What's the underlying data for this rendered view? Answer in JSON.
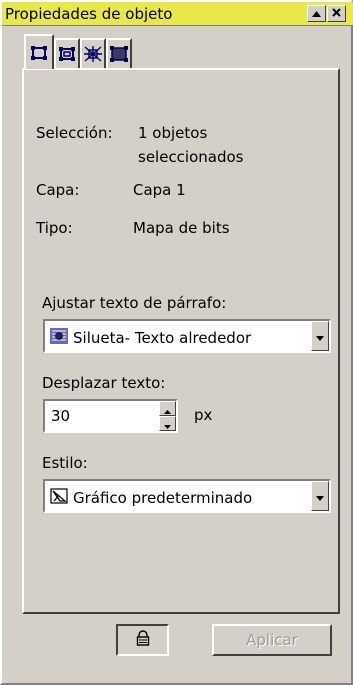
{
  "window": {
    "title": "Propiedades de objeto"
  },
  "tabs": [
    {
      "name": "tab-general",
      "icon": "object-frame-icon",
      "active": true
    },
    {
      "name": "tab-outline",
      "icon": "outline-frame-icon",
      "active": false
    },
    {
      "name": "tab-wrap",
      "icon": "wrap-text-icon",
      "active": false
    },
    {
      "name": "tab-fill",
      "icon": "fill-frame-icon",
      "active": false
    }
  ],
  "info": {
    "selection_label": "Selección:",
    "selection_value_line1": "1 objetos",
    "selection_value_line2": "seleccionados",
    "layer_label": "Capa:",
    "layer_value": "Capa 1",
    "type_label": "Tipo:",
    "type_value": "Mapa de bits"
  },
  "wrap": {
    "label": "Ajustar texto de párrafo:",
    "value": "Silueta- Texto alrededor",
    "icon": "contour-wrap-icon"
  },
  "offset": {
    "label": "Desplazar texto:",
    "value": "30",
    "unit": "px"
  },
  "style": {
    "label": "Estilo:",
    "value": "Gráfico predeterminado",
    "icon": "graphic-style-icon"
  },
  "buttons": {
    "lock_icon": "lock-icon",
    "apply_label": "Aplicar",
    "apply_enabled": false
  }
}
